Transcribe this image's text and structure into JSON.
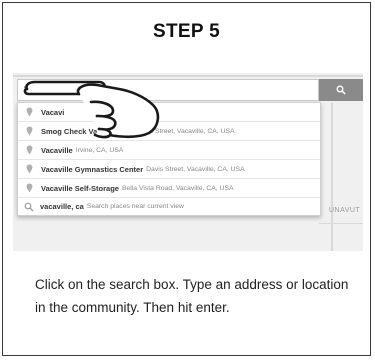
{
  "step": {
    "title": "STEP 5"
  },
  "map": {
    "search_value": "V",
    "region_label": "UNAVUT",
    "suggestions": [
      {
        "main": "Vacavi",
        "sub": "",
        "icon": "pin-icon"
      },
      {
        "main": "Smog Check Vacaville CA",
        "sub": "Davis Street, Vacaville, CA, USA",
        "icon": "pin-icon"
      },
      {
        "main": "Vacaville",
        "sub": "Irvine, CA, USA",
        "icon": "pin-icon"
      },
      {
        "main": "Vacaville Gymnastics Center",
        "sub": "Davis Street, Vacaville, CA, USA",
        "icon": "pin-icon"
      },
      {
        "main": "Vacaville Self-Storage",
        "sub": "Bella Vista Road, Vacaville, CA, USA",
        "icon": "pin-icon"
      }
    ],
    "query_suggestion": {
      "main": "vacaville, ca",
      "sub": "Search places near current view",
      "icon": "search-icon"
    }
  },
  "instructions": {
    "text": "Click on the search box. Type an address or location in the community. Then hit enter."
  },
  "colors": {
    "search_button": "#8a8a8a",
    "border": "#3a3a3a"
  }
}
